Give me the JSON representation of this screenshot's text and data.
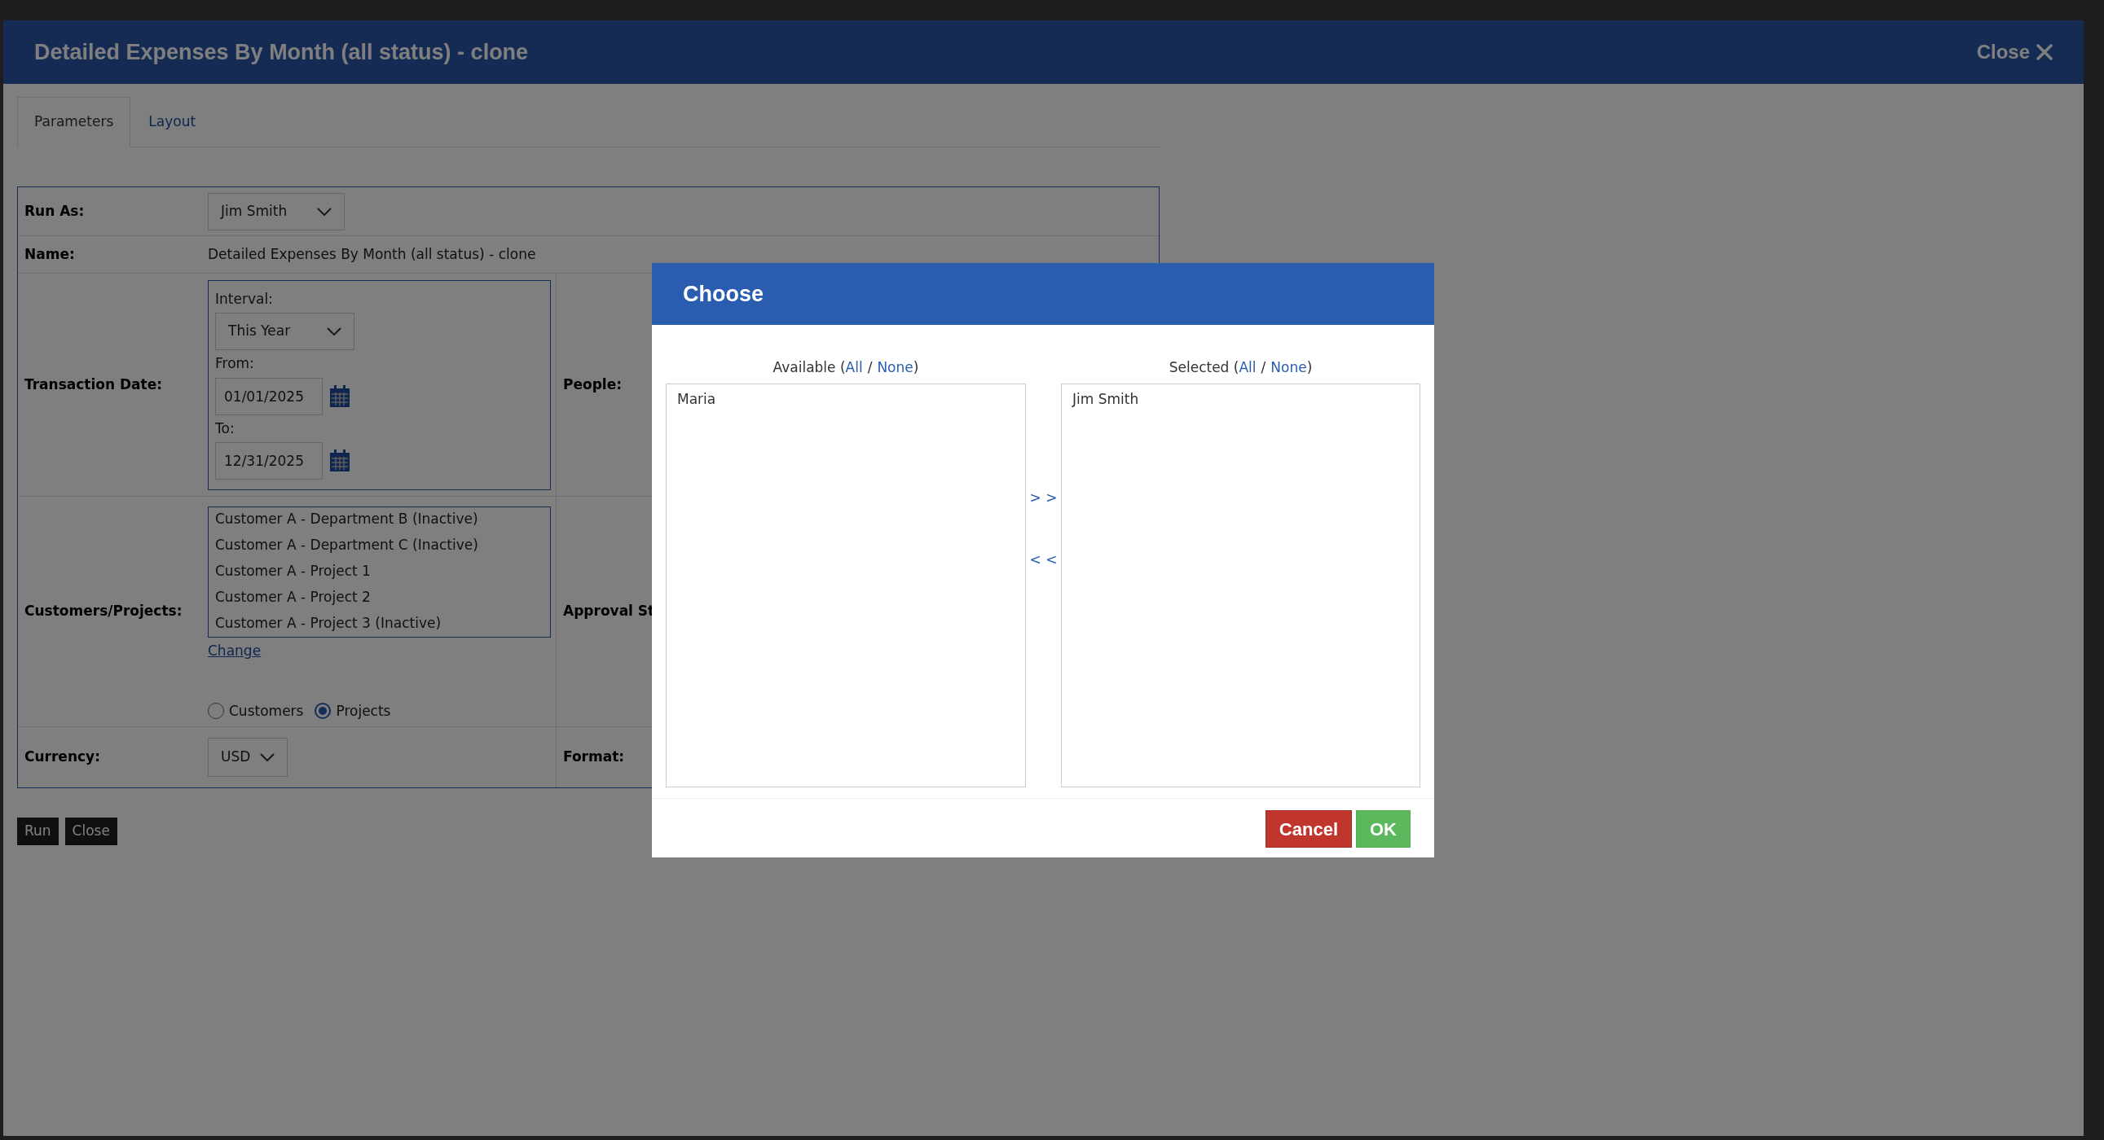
{
  "dialog": {
    "title": "Detailed Expenses By Month (all status) - clone",
    "close_label": "Close"
  },
  "tabs": [
    {
      "label": "Parameters",
      "selected": true
    },
    {
      "label": "Layout",
      "selected": false
    }
  ],
  "run_as": {
    "label": "Run As:",
    "value": "Jim Smith"
  },
  "name": {
    "label": "Name:",
    "value": "Detailed Expenses By Month (all status) - clone"
  },
  "transaction_date": {
    "label": "Transaction Date:",
    "interval_label": "Interval:",
    "interval": "This Year",
    "from_label": "From:",
    "from": "01/01/2025",
    "to_label": "To:",
    "to": "12/31/2025"
  },
  "customers_projects": {
    "label": "Customers/Projects:",
    "items": [
      "Customer A - Department B (Inactive)",
      "Customer A - Department C (Inactive)",
      "Customer A - Project 1",
      "Customer A - Project 2",
      "Customer A - Project 3 (Inactive)"
    ],
    "change_link": "Change",
    "options": [
      {
        "label": "Customers",
        "selected": false
      },
      {
        "label": "Projects",
        "selected": true
      }
    ]
  },
  "currency": {
    "label": "Currency:",
    "value": "USD"
  },
  "right_labels": [
    "People:",
    "Approval St",
    "Format:"
  ],
  "buttons": [
    "Run",
    "Close"
  ],
  "chooser": {
    "title": "Choose",
    "lists": [
      {
        "prefix": "Available (",
        "all": "All",
        "separator": "/",
        "none": "None",
        "suffix": ")",
        "items": [
          "Maria"
        ]
      },
      {
        "prefix": "Selected (",
        "all": "All",
        "separator": "/",
        "none": "None",
        "suffix": ")",
        "items": [
          "Jim Smith"
        ]
      }
    ],
    "move_right": "> >",
    "move_left": "< <",
    "cancel": "Cancel",
    "ok": "OK"
  }
}
